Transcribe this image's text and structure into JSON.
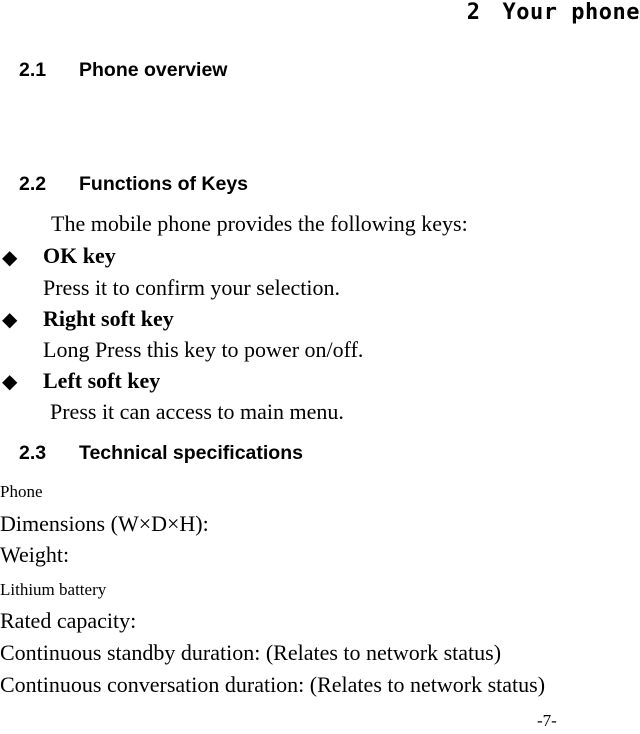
{
  "chapter": {
    "number": "2",
    "title": "Your phone"
  },
  "sections": [
    {
      "number": "2.1",
      "title": "Phone overview"
    },
    {
      "number": "2.2",
      "title": "Functions of Keys"
    },
    {
      "number": "2.3",
      "title": "Technical specifications"
    }
  ],
  "keys": {
    "intro": "The mobile phone provides the following keys:",
    "bullet_icon": "diamond-bullet-icon",
    "items": [
      {
        "name": "OK key",
        "description": "Press it to confirm your selection."
      },
      {
        "name": "Right soft key",
        "description": "Long Press this key to power on/off."
      },
      {
        "name": "Left soft key",
        "description": "Press it can access to main menu."
      }
    ]
  },
  "specs": {
    "phone_label": "Phone",
    "dimensions": "Dimensions (W×D×H):",
    "weight": "Weight:",
    "battery_label": "Lithium battery",
    "rated_capacity": "Rated capacity:",
    "standby": "Continuous standby duration: (Relates to network status)",
    "conversation": "Continuous conversation duration: (Relates to network status)"
  },
  "page_number": "-7-"
}
